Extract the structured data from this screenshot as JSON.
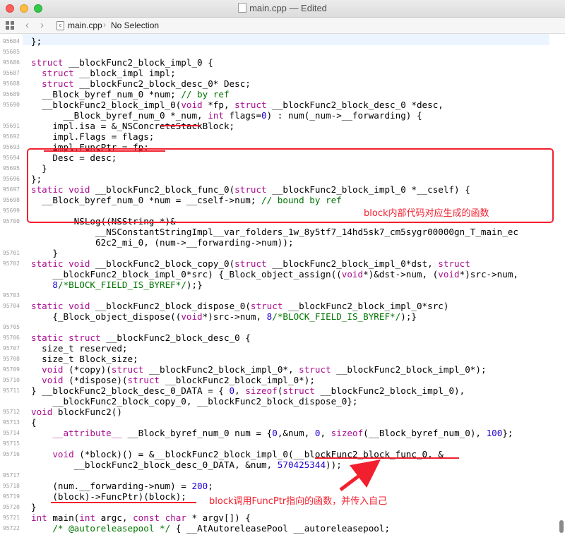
{
  "window": {
    "title": "main.cpp — Edited"
  },
  "jumpbar": {
    "file": "main.cpp",
    "selection": "No Selection"
  },
  "annotations": {
    "box_note": "block内部代码对应生成的函数",
    "arrow_note": "block调用FuncPtr指向的函数，并传入自己",
    "color": "#f2202e"
  },
  "colors": {
    "keyword": "#aa0d91",
    "number": "#1c00cf",
    "comment": "#007400",
    "current_line": "#ecf5ff"
  },
  "lines": [
    {
      "n": "95684",
      "s": [
        [
          "",
          "};"
        ]
      ]
    },
    {
      "n": "95685",
      "s": []
    },
    {
      "n": "95686",
      "s": [
        [
          "kw",
          "struct"
        ],
        [
          "",
          " __blockFunc2_block_impl_0 {"
        ]
      ]
    },
    {
      "n": "95687",
      "s": [
        [
          "",
          "  "
        ],
        [
          "kw",
          "struct"
        ],
        [
          "",
          " __block_impl impl;"
        ]
      ]
    },
    {
      "n": "95688",
      "s": [
        [
          "",
          "  "
        ],
        [
          "kw",
          "struct"
        ],
        [
          "",
          " __blockFunc2_block_desc_0* Desc;"
        ]
      ]
    },
    {
      "n": "95689",
      "s": [
        [
          "",
          "  __Block_byref_num_0 *num; "
        ],
        [
          "cm",
          "// by ref"
        ]
      ]
    },
    {
      "n": "95690",
      "s": [
        [
          "",
          "  __blockFunc2_block_impl_0("
        ],
        [
          "kw",
          "void"
        ],
        [
          "",
          " *fp, "
        ],
        [
          "kw",
          "struct"
        ],
        [
          "",
          " __blockFunc2_block_desc_0 *desc,"
        ]
      ]
    },
    {
      "n": "",
      "s": [
        [
          "",
          "      __Block_byref_num_0 *_num, "
        ],
        [
          "kw",
          "int"
        ],
        [
          "",
          " flags="
        ],
        [
          "num",
          "0"
        ],
        [
          "",
          ") : num(_num->__forwarding) {"
        ]
      ]
    },
    {
      "n": "95691",
      "s": [
        [
          "",
          "    impl.isa = &_NSConcreteStackBlock;"
        ]
      ]
    },
    {
      "n": "95692",
      "s": [
        [
          "",
          "    impl.Flags = flags;"
        ]
      ]
    },
    {
      "n": "95693",
      "s": [
        [
          "",
          "    impl.FuncPtr = fp;"
        ]
      ]
    },
    {
      "n": "95694",
      "s": [
        [
          "",
          "    Desc = desc;"
        ]
      ]
    },
    {
      "n": "95695",
      "s": [
        [
          "",
          "  }"
        ]
      ]
    },
    {
      "n": "95696",
      "s": [
        [
          "",
          "};"
        ]
      ]
    },
    {
      "n": "95697",
      "s": [
        [
          "kw",
          "static"
        ],
        [
          "",
          " "
        ],
        [
          "kw",
          "void"
        ],
        [
          "",
          " __blockFunc2_block_func_0("
        ],
        [
          "kw",
          "struct"
        ],
        [
          "",
          " __blockFunc2_block_impl_0 *__cself) {"
        ]
      ]
    },
    {
      "n": "95698",
      "s": [
        [
          "",
          "  __Block_byref_num_0 *num = __cself->num; "
        ],
        [
          "cm",
          "// bound by ref"
        ]
      ]
    },
    {
      "n": "95699",
      "s": []
    },
    {
      "n": "95700",
      "s": [
        [
          "",
          "        NSLog((NSString *)&"
        ]
      ]
    },
    {
      "n": "",
      "s": [
        [
          "",
          "            __NSConstantStringImpl__var_folders_1w_8y5tf7_14hd5sk7_cm5sygr00000gn_T_main_ec"
        ]
      ]
    },
    {
      "n": "",
      "s": [
        [
          "",
          "            62c2_mi_0, (num->__forwarding->num));"
        ]
      ]
    },
    {
      "n": "95701",
      "s": [
        [
          "",
          "    }"
        ]
      ]
    },
    {
      "n": "95702",
      "s": [
        [
          "kw",
          "static"
        ],
        [
          "",
          " "
        ],
        [
          "kw",
          "void"
        ],
        [
          "",
          " __blockFunc2_block_copy_0("
        ],
        [
          "kw",
          "struct"
        ],
        [
          "",
          " __blockFunc2_block_impl_0*dst, "
        ],
        [
          "kw",
          "struct"
        ]
      ]
    },
    {
      "n": "",
      "s": [
        [
          "",
          "    __blockFunc2_block_impl_0*src) {_Block_object_assign(("
        ],
        [
          "kw",
          "void"
        ],
        [
          "",
          "*)&dst->num, ("
        ],
        [
          "kw",
          "void"
        ],
        [
          "",
          "*)src->num,"
        ]
      ]
    },
    {
      "n": "",
      "s": [
        [
          "",
          "    "
        ],
        [
          "num",
          "8"
        ],
        [
          "cm",
          "/*BLOCK_FIELD_IS_BYREF*/"
        ],
        [
          "",
          ");}"
        ]
      ]
    },
    {
      "n": "95703",
      "s": []
    },
    {
      "n": "95704",
      "s": [
        [
          "kw",
          "static"
        ],
        [
          "",
          " "
        ],
        [
          "kw",
          "void"
        ],
        [
          "",
          " __blockFunc2_block_dispose_0("
        ],
        [
          "kw",
          "struct"
        ],
        [
          "",
          " __blockFunc2_block_impl_0*src)"
        ]
      ]
    },
    {
      "n": "",
      "s": [
        [
          "",
          "    {_Block_object_dispose(("
        ],
        [
          "kw",
          "void"
        ],
        [
          "",
          "*)src->num, "
        ],
        [
          "num",
          "8"
        ],
        [
          "cm",
          "/*BLOCK_FIELD_IS_BYREF*/"
        ],
        [
          "",
          ");}"
        ]
      ]
    },
    {
      "n": "95705",
      "s": []
    },
    {
      "n": "95706",
      "s": [
        [
          "kw",
          "static"
        ],
        [
          "",
          " "
        ],
        [
          "kw",
          "struct"
        ],
        [
          "",
          " __blockFunc2_block_desc_0 {"
        ]
      ]
    },
    {
      "n": "95707",
      "s": [
        [
          "",
          "  size_t reserved;"
        ]
      ]
    },
    {
      "n": "95708",
      "s": [
        [
          "",
          "  size_t Block_size;"
        ]
      ]
    },
    {
      "n": "95709",
      "s": [
        [
          "",
          "  "
        ],
        [
          "kw",
          "void"
        ],
        [
          "",
          " (*copy)("
        ],
        [
          "kw",
          "struct"
        ],
        [
          "",
          " __blockFunc2_block_impl_0*, "
        ],
        [
          "kw",
          "struct"
        ],
        [
          "",
          " __blockFunc2_block_impl_0*);"
        ]
      ]
    },
    {
      "n": "95710",
      "s": [
        [
          "",
          "  "
        ],
        [
          "kw",
          "void"
        ],
        [
          "",
          " (*dispose)("
        ],
        [
          "kw",
          "struct"
        ],
        [
          "",
          " __blockFunc2_block_impl_0*);"
        ]
      ]
    },
    {
      "n": "95711",
      "s": [
        [
          "",
          "} __blockFunc2_block_desc_0_DATA = { "
        ],
        [
          "num",
          "0"
        ],
        [
          "",
          ", "
        ],
        [
          "kw",
          "sizeof"
        ],
        [
          "",
          "("
        ],
        [
          "kw",
          "struct"
        ],
        [
          "",
          " __blockFunc2_block_impl_0),"
        ]
      ]
    },
    {
      "n": "",
      "s": [
        [
          "",
          "    __blockFunc2_block_copy_0, __blockFunc2_block_dispose_0};"
        ]
      ]
    },
    {
      "n": "95712",
      "s": [
        [
          "kw",
          "void"
        ],
        [
          "",
          " blockFunc2()"
        ]
      ]
    },
    {
      "n": "95713",
      "s": [
        [
          "",
          "{"
        ]
      ]
    },
    {
      "n": "95714",
      "s": [
        [
          "",
          "    "
        ],
        [
          "kw",
          "__attribute__"
        ],
        [
          "",
          " __Block_byref_num_0 num = {"
        ],
        [
          "num",
          "0"
        ],
        [
          "",
          ",&num, "
        ],
        [
          "num",
          "0"
        ],
        [
          "",
          ", "
        ],
        [
          "kw",
          "sizeof"
        ],
        [
          "",
          "(__Block_byref_num_0), "
        ],
        [
          "num",
          "100"
        ],
        [
          "",
          "};"
        ]
      ]
    },
    {
      "n": "95715",
      "s": []
    },
    {
      "n": "95716",
      "s": [
        [
          "",
          "    "
        ],
        [
          "kw",
          "void"
        ],
        [
          "",
          " (*block)() = &__blockFunc2_block_impl_0(__blockFunc2_block_func_0, &"
        ]
      ]
    },
    {
      "n": "",
      "s": [
        [
          "",
          "        __blockFunc2_block_desc_0_DATA, &num, "
        ],
        [
          "num",
          "570425344"
        ],
        [
          "",
          "));"
        ]
      ]
    },
    {
      "n": "95717",
      "s": []
    },
    {
      "n": "95718",
      "s": [
        [
          "",
          "    (num.__forwarding->num) = "
        ],
        [
          "num",
          "200"
        ],
        [
          "",
          ";"
        ]
      ]
    },
    {
      "n": "95719",
      "s": [
        [
          "",
          "    (block)->FuncPtr)(block);"
        ]
      ]
    },
    {
      "n": "95720",
      "s": [
        [
          "",
          "}"
        ]
      ]
    },
    {
      "n": "95721",
      "s": [
        [
          "kw",
          "int"
        ],
        [
          "",
          " main("
        ],
        [
          "kw",
          "int"
        ],
        [
          "",
          " argc, "
        ],
        [
          "kw",
          "const"
        ],
        [
          "",
          " "
        ],
        [
          "kw",
          "char"
        ],
        [
          "",
          " * argv[]) {"
        ]
      ]
    },
    {
      "n": "95722",
      "s": [
        [
          "",
          "    "
        ],
        [
          "cm",
          "/* @autoreleasepool */"
        ],
        [
          "",
          " { __AtAutoreleasePool __autoreleasepool;"
        ]
      ]
    }
  ]
}
